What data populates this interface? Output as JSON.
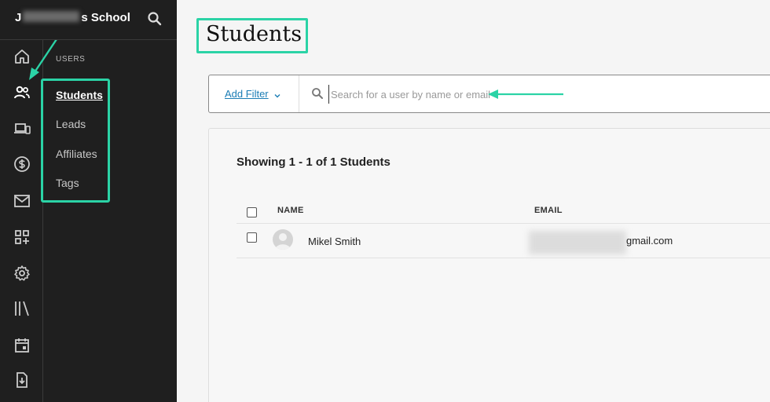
{
  "brand": {
    "prefix": "J",
    "suffix": "s School"
  },
  "sidebar": {
    "section_title": "USERS",
    "items": [
      {
        "label": "Students",
        "active": true
      },
      {
        "label": "Leads"
      },
      {
        "label": "Affiliates"
      },
      {
        "label": "Tags"
      }
    ],
    "rail_icons": [
      "home-icon",
      "users-icon",
      "devices-icon",
      "dollar-icon",
      "mail-icon",
      "apps-add-icon",
      "gear-icon",
      "library-icon",
      "calendar-icon",
      "download-file-icon"
    ]
  },
  "main": {
    "title": "Students",
    "filter": {
      "label": "Add Filter"
    },
    "search": {
      "placeholder": "Search for a user by name or email"
    },
    "showing": "Showing 1 - 1 of 1 Students",
    "table": {
      "columns": [
        "NAME",
        "EMAIL"
      ],
      "rows": [
        {
          "name": "Mikel Smith",
          "email_visible": "gmail.com"
        }
      ]
    }
  },
  "colors": {
    "accent": "#2bd3a6",
    "sidebar_bg": "#1f1f1f",
    "link": "#1b7db5"
  }
}
